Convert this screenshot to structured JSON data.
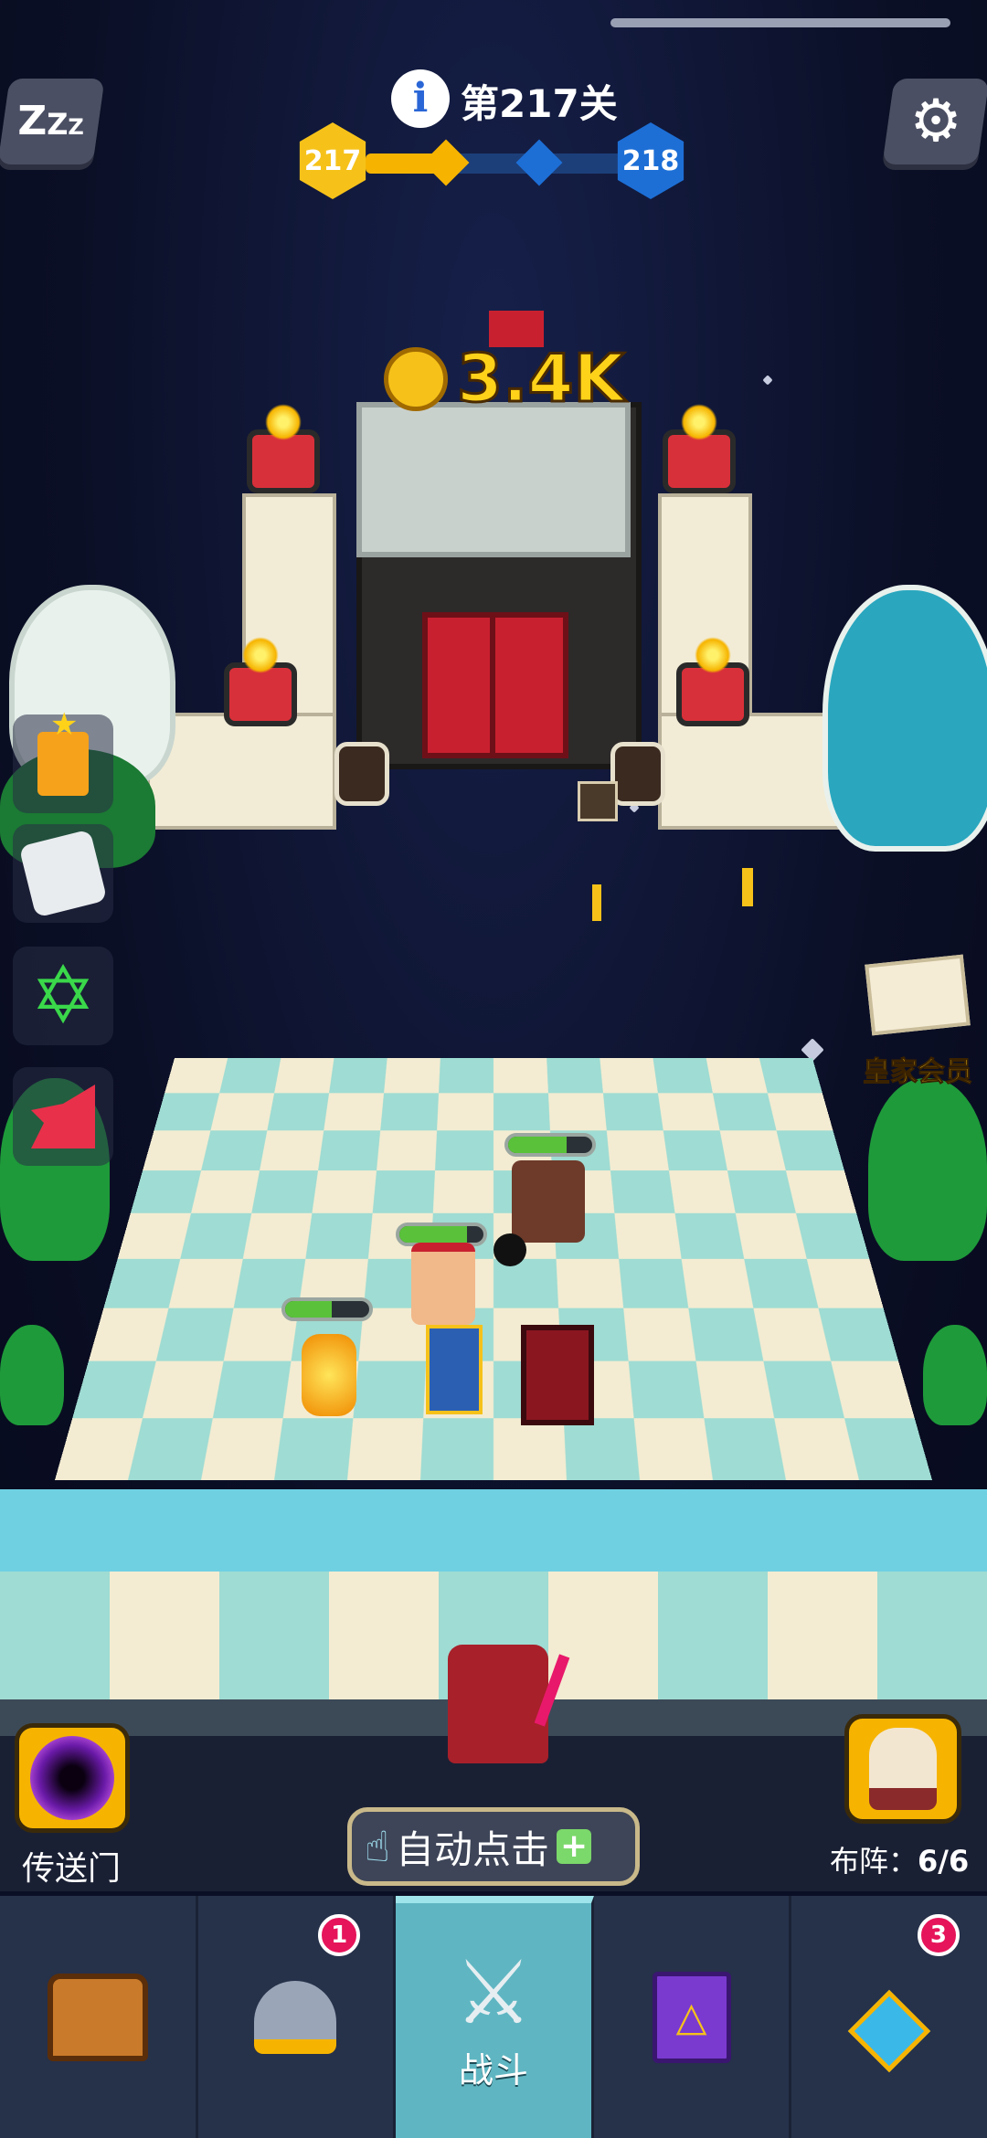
{
  "hud": {
    "level_prefix": "第",
    "level_number": "217",
    "level_suffix": "关",
    "current_stage": "217",
    "next_stage": "218",
    "sleep_label": "Z",
    "reward": "3.4K"
  },
  "side_menu": {
    "vip_label": "皇家会员"
  },
  "portal": {
    "label": "传送门"
  },
  "auto_click": {
    "label": "自动点击"
  },
  "formation": {
    "label": "布阵：",
    "value": "6/6"
  },
  "nav": {
    "tabs": [
      {
        "label": "",
        "icon": "treasure-chest-icon",
        "badge": ""
      },
      {
        "label": "",
        "icon": "winged-helmet-icon",
        "badge": "1"
      },
      {
        "label": "战斗",
        "icon": "crossed-swords-icon",
        "badge": ""
      },
      {
        "label": "",
        "icon": "spellbook-icon",
        "badge": ""
      },
      {
        "label": "",
        "icon": "amulet-icon",
        "badge": "3"
      }
    ],
    "active_tab": 2
  },
  "colors": {
    "accent_gold": "#f6b400",
    "stage_blue": "#1d6fd6",
    "health_green": "#59c23a",
    "nav_active": "#5fb6c2"
  }
}
